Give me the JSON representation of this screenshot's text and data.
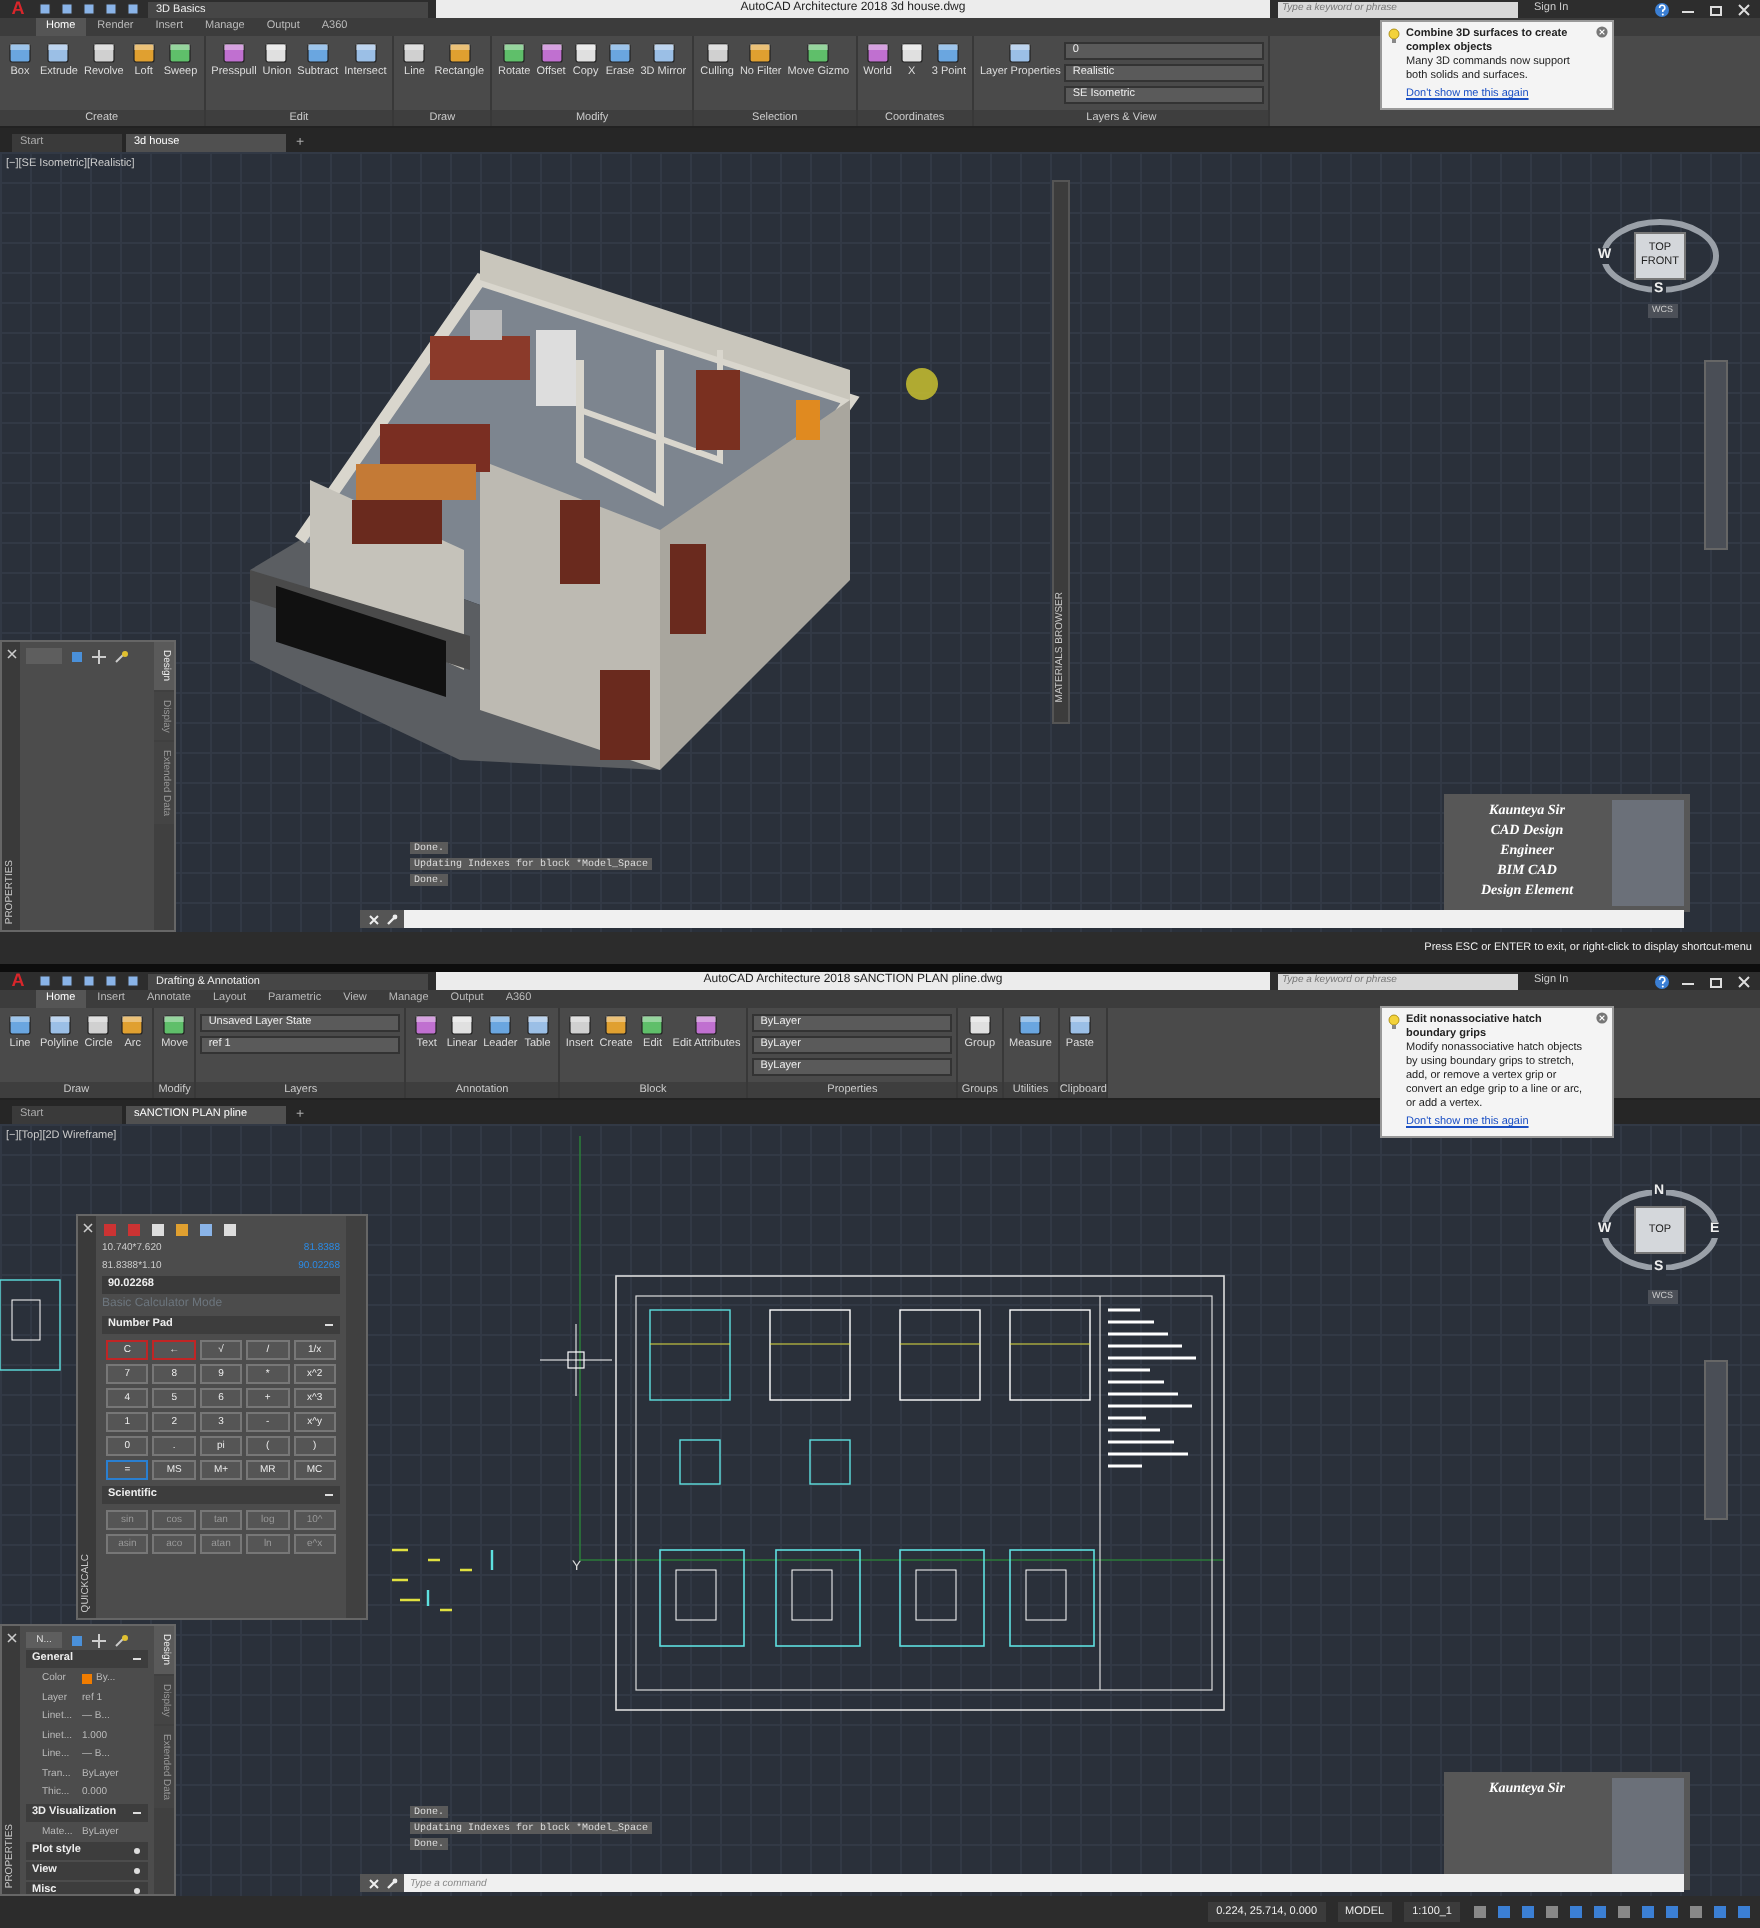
{
  "screens": [
    {
      "kind": "house_3d",
      "title_bar": {
        "logo": "A",
        "workspace": "3D Basics",
        "title": "AutoCAD Architecture 2018   3d house.dwg",
        "search": {
          "placeholder": "Type a keyword or phrase"
        },
        "sign_in": "Sign In"
      },
      "ribbon_tabs": [
        {
          "label": "Home",
          "selected": true
        },
        {
          "label": "Render",
          "selected": false
        },
        {
          "label": "Insert",
          "selected": false
        },
        {
          "label": "Manage",
          "selected": false
        },
        {
          "label": "Output",
          "selected": false
        },
        {
          "label": "A360",
          "selected": false
        }
      ],
      "ribbon_panels": [
        {
          "title": "Create",
          "tools": [
            "Box",
            "Extrude",
            "Revolve",
            "Loft",
            "Sweep"
          ]
        },
        {
          "title": "Edit",
          "tools": [
            "Presspull",
            "Union",
            "Subtract",
            "Intersect"
          ]
        },
        {
          "title": "Draw",
          "tools": [
            "Line",
            "Rectangle"
          ]
        },
        {
          "title": "Modify",
          "tools": [
            "Rotate",
            "Offset",
            "Copy",
            "Erase",
            "3D Mirror"
          ]
        },
        {
          "title": "Selection",
          "tools": [
            "Culling",
            "No Filter",
            "Move Gizmo"
          ]
        },
        {
          "title": "Coordinates",
          "tools": [
            "World",
            "X",
            "3 Point"
          ]
        },
        {
          "title": "Layers & View",
          "tools": [
            "Layer Properties"
          ],
          "dropdowns": [
            "0",
            "Realistic",
            "SE Isometric"
          ]
        }
      ],
      "tooltip": {
        "title": "Combine 3D surfaces to create complex objects",
        "body": "Many 3D commands now support both solids and surfaces.",
        "link": "Don't show me this again"
      },
      "doc_tabs": [
        {
          "label": "Start",
          "selected": false
        },
        {
          "label": "3d house",
          "selected": true
        }
      ],
      "new_tab": "+",
      "viewport_label": "[−][SE Isometric][Realistic]",
      "viewcube": {
        "faces": [
          "TOP",
          "FRONT"
        ],
        "compass": {
          "left": "W",
          "bottom": "S"
        },
        "wcs": "WCS"
      },
      "side_bar": {
        "title": "MATERIALS BROWSER"
      },
      "palettes": [
        {
          "kind": "properties",
          "title": "PROPERTIES",
          "tabs": [
            {
              "label": "Design",
              "selected": true
            },
            {
              "label": "Display",
              "selected": false
            },
            {
              "label": "Extended Data",
              "selected": false
            }
          ]
        }
      ],
      "command_history": [
        "Done.",
        "Updating Indexes for block *Model_Space",
        "Done."
      ],
      "presenter": {
        "lines": [
          "Kaunteya Sir",
          "CAD Design",
          "Engineer",
          "BIM CAD",
          "Design Element"
        ]
      },
      "status_bar": {
        "message": "Press ESC or ENTER to exit, or right-click to display shortcut-menu"
      }
    },
    {
      "kind": "floor_plan",
      "title_bar": {
        "logo": "A",
        "workspace": "Drafting & Annotation",
        "title": "AutoCAD Architecture 2018   sANCTION PLAN pline.dwg",
        "search": {
          "placeholder": "Type a keyword or phrase"
        },
        "sign_in": "Sign In"
      },
      "ribbon_tabs": [
        {
          "label": "Home",
          "selected": true
        },
        {
          "label": "Insert",
          "selected": false
        },
        {
          "label": "Annotate",
          "selected": false
        },
        {
          "label": "Layout",
          "selected": false
        },
        {
          "label": "Parametric",
          "selected": false
        },
        {
          "label": "View",
          "selected": false
        },
        {
          "label": "Manage",
          "selected": false
        },
        {
          "label": "Output",
          "selected": false
        },
        {
          "label": "A360",
          "selected": false
        }
      ],
      "ribbon_panels": [
        {
          "title": "Draw",
          "tools": [
            "Line",
            "Polyline",
            "Circle",
            "Arc"
          ]
        },
        {
          "title": "Modify",
          "tools": [
            "Move"
          ]
        },
        {
          "title": "Layers",
          "dropdowns": [
            "Unsaved Layer State",
            "ref 1"
          ]
        },
        {
          "title": "Annotation",
          "tools": [
            "Text",
            "Linear",
            "Leader",
            "Table"
          ]
        },
        {
          "title": "Block",
          "tools": [
            "Insert",
            "Create",
            "Edit",
            "Edit Attributes"
          ]
        },
        {
          "title": "Properties",
          "dropdowns": [
            "ByLayer",
            "ByLayer",
            "ByLayer"
          ]
        },
        {
          "title": "Groups",
          "tools": [
            "Group"
          ]
        },
        {
          "title": "Utilities",
          "tools": [
            "Measure"
          ]
        },
        {
          "title": "Clipboard",
          "tools": [
            "Paste"
          ]
        }
      ],
      "tooltip": {
        "title": "Edit nonassociative hatch boundary grips",
        "body": "Modify nonassociative hatch objects by using boundary grips to stretch, add, or remove a vertex grip or convert an edge grip to a line or arc, or add a vertex.",
        "link": "Don't show me this again"
      },
      "doc_tabs": [
        {
          "label": "Start",
          "selected": false
        },
        {
          "label": "sANCTION PLAN pline",
          "selected": true
        }
      ],
      "new_tab": "+",
      "viewport_label": "[−][Top][2D Wireframe]",
      "viewcube": {
        "faces": [
          "TOP"
        ],
        "compass": {
          "top": "N",
          "left": "W",
          "right": "E",
          "bottom": "S"
        },
        "wcs": "WCS"
      },
      "ucs_label": "Y",
      "palettes": [
        {
          "kind": "calculator",
          "title": "QUICKCALC",
          "history": [
            {
              "expression": "10.740*7.620",
              "result": "81.8388"
            },
            {
              "expression": "81.8388*1.10",
              "result": "90.02268"
            }
          ],
          "input": "90.02268",
          "mode": "Basic Calculator Mode",
          "pads": [
            {
              "title": "Number Pad",
              "keys": [
                {
                  "label": "C",
                  "kind": "clear"
                },
                {
                  "label": "←",
                  "kind": "clear"
                },
                {
                  "label": "√",
                  "kind": "key"
                },
                {
                  "label": "/",
                  "kind": "key"
                },
                {
                  "label": "1/x",
                  "kind": "key"
                },
                {
                  "label": "7",
                  "kind": "key"
                },
                {
                  "label": "8",
                  "kind": "key"
                },
                {
                  "label": "9",
                  "kind": "key"
                },
                {
                  "label": "*",
                  "kind": "key"
                },
                {
                  "label": "x^2",
                  "kind": "key"
                },
                {
                  "label": "4",
                  "kind": "key"
                },
                {
                  "label": "5",
                  "kind": "key"
                },
                {
                  "label": "6",
                  "kind": "key"
                },
                {
                  "label": "+",
                  "kind": "key"
                },
                {
                  "label": "x^3",
                  "kind": "key"
                },
                {
                  "label": "1",
                  "kind": "key"
                },
                {
                  "label": "2",
                  "kind": "key"
                },
                {
                  "label": "3",
                  "kind": "key"
                },
                {
                  "label": "-",
                  "kind": "key"
                },
                {
                  "label": "x^y",
                  "kind": "key"
                },
                {
                  "label": "0",
                  "kind": "key"
                },
                {
                  "label": ".",
                  "kind": "key"
                },
                {
                  "label": "pi",
                  "kind": "key"
                },
                {
                  "label": "(",
                  "kind": "key"
                },
                {
                  "label": ")",
                  "kind": "key"
                },
                {
                  "label": "=",
                  "kind": "equals"
                },
                {
                  "label": "MS",
                  "kind": "key"
                },
                {
                  "label": "M+",
                  "kind": "key"
                },
                {
                  "label": "MR",
                  "kind": "key"
                },
                {
                  "label": "MC",
                  "kind": "key"
                }
              ]
            },
            {
              "title": "Scientific",
              "keys": [
                {
                  "label": "sin",
                  "kind": "key"
                },
                {
                  "label": "cos",
                  "kind": "key"
                },
                {
                  "label": "tan",
                  "kind": "key"
                },
                {
                  "label": "log",
                  "kind": "key"
                },
                {
                  "label": "10^",
                  "kind": "key"
                },
                {
                  "label": "asin",
                  "kind": "key"
                },
                {
                  "label": "aco",
                  "kind": "key"
                },
                {
                  "label": "atan",
                  "kind": "key"
                },
                {
                  "label": "ln",
                  "kind": "key"
                },
                {
                  "label": "e^x",
                  "kind": "key"
                }
              ]
            }
          ]
        },
        {
          "kind": "properties",
          "title": "PROPERTIES",
          "selector": "N...",
          "tabs": [
            {
              "label": "Design",
              "selected": true
            },
            {
              "label": "Display",
              "selected": false
            },
            {
              "label": "Extended Data",
              "selected": false
            }
          ],
          "sections": [
            {
              "title": "General",
              "expanded": true,
              "rows": [
                {
                  "label": "Color",
                  "value": "By...",
                  "color": "#f07c00"
                },
                {
                  "label": "Layer",
                  "value": "ref 1"
                },
                {
                  "label": "Linet...",
                  "value": "— B..."
                },
                {
                  "label": "Linet...",
                  "value": "1.000"
                },
                {
                  "label": "Line...",
                  "value": "— B..."
                },
                {
                  "label": "Tran...",
                  "value": "ByLayer"
                },
                {
                  "label": "Thic...",
                  "value": "0.000"
                }
              ]
            },
            {
              "title": "3D Visualization",
              "expanded": true,
              "rows": [
                {
                  "label": "Mate...",
                  "value": "ByLayer"
                }
              ]
            },
            {
              "title": "Plot style",
              "expanded": false
            },
            {
              "title": "View",
              "expanded": false
            },
            {
              "title": "Misc",
              "expanded": false
            }
          ]
        }
      ],
      "command_history": [
        "Done.",
        "Updating Indexes for block *Model_Space",
        "Done."
      ],
      "command_line": {
        "placeholder": "Type a command"
      },
      "presenter": {
        "lines": [
          "Kaunteya Sir"
        ]
      },
      "status_bar": {
        "items": [
          "0.224, 25.714, 0.000",
          "MODEL",
          "1:100_1"
        ]
      }
    }
  ]
}
